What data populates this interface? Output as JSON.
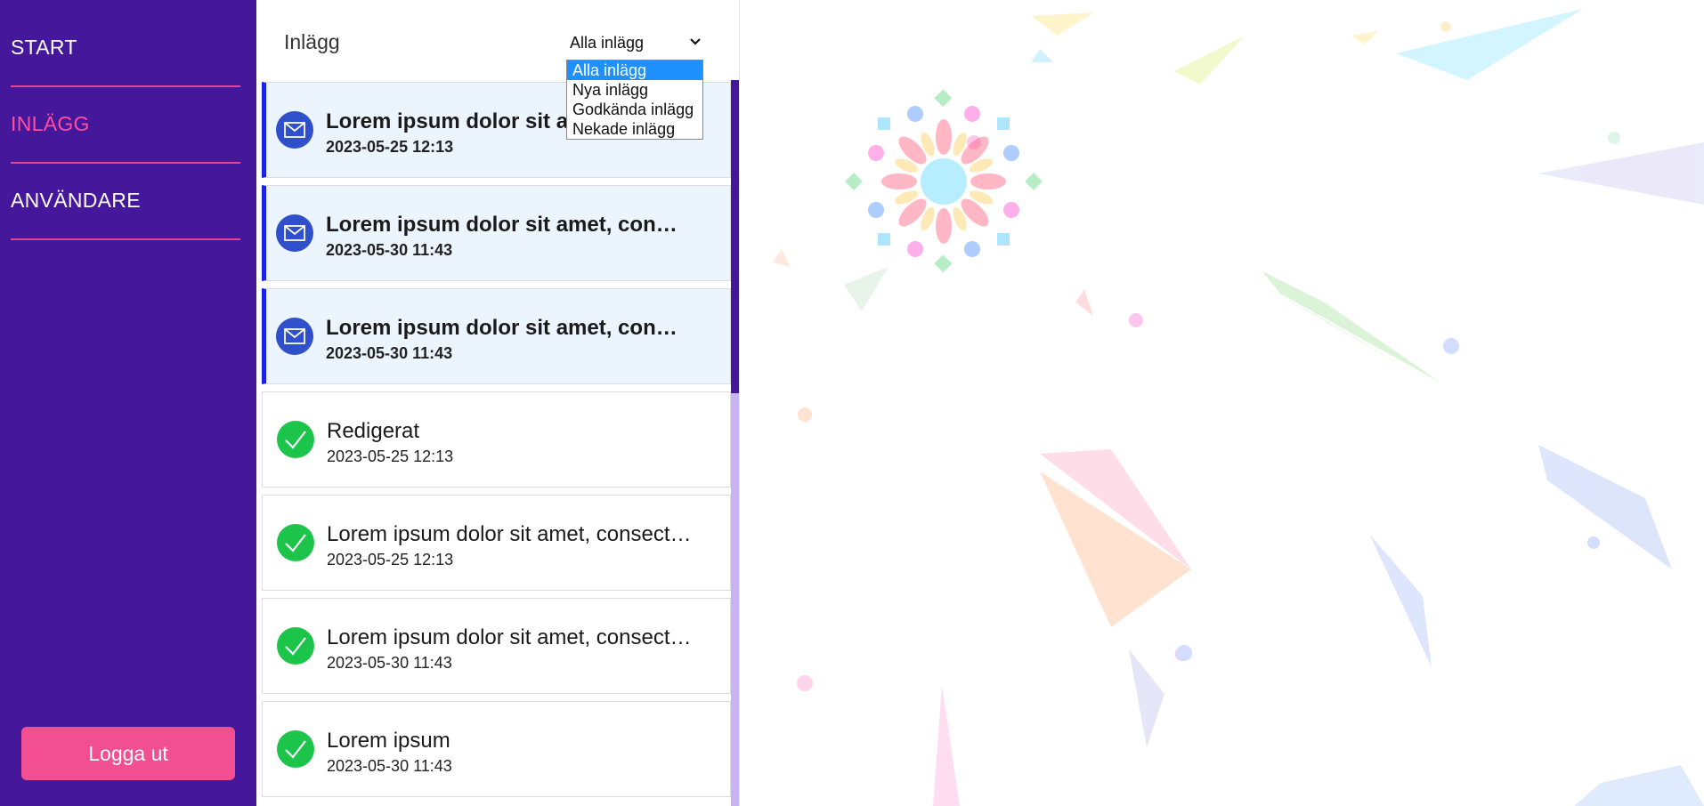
{
  "sidebar": {
    "items": [
      {
        "label": "START"
      },
      {
        "label": "INLÄGG"
      },
      {
        "label": "ANVÄNDARE"
      }
    ],
    "logout_label": "Logga ut"
  },
  "panel": {
    "title": "Inlägg",
    "filter": {
      "selected": "Alla inlägg",
      "options": [
        "Alla inlägg",
        "Nya inlägg",
        "Godkända inlägg",
        "Nekade inlägg"
      ]
    }
  },
  "posts": [
    {
      "title": "Lorem ipsum dolor sit amet, consectetur",
      "date": "2023-05-25 12:13",
      "status": "new",
      "icon": "envelope-icon"
    },
    {
      "title": "Lorem ipsum dolor sit amet, consectetur",
      "date": "2023-05-30 11:43",
      "status": "new",
      "icon": "envelope-icon"
    },
    {
      "title": "Lorem ipsum dolor sit amet, consectetur",
      "date": "2023-05-30 11:43",
      "status": "new",
      "icon": "envelope-icon"
    },
    {
      "title": "Redigerat",
      "date": "2023-05-25 12:13",
      "status": "approved",
      "icon": "checkmark-icon"
    },
    {
      "title": "Lorem ipsum dolor sit amet, consectetur adipiscing",
      "date": "2023-05-25 12:13",
      "status": "approved",
      "icon": "checkmark-icon"
    },
    {
      "title": "Lorem ipsum dolor sit amet, consectetur adipiscing",
      "date": "2023-05-30 11:43",
      "status": "approved",
      "icon": "checkmark-icon"
    },
    {
      "title": "Lorem ipsum",
      "date": "2023-05-30 11:43",
      "status": "approved",
      "icon": "checkmark-icon"
    }
  ],
  "colors": {
    "sidebar_bg": "#45179a",
    "accent_pink": "#f24f92",
    "unread_bar": "#1a22e6",
    "approved_green": "#1dc44a"
  }
}
